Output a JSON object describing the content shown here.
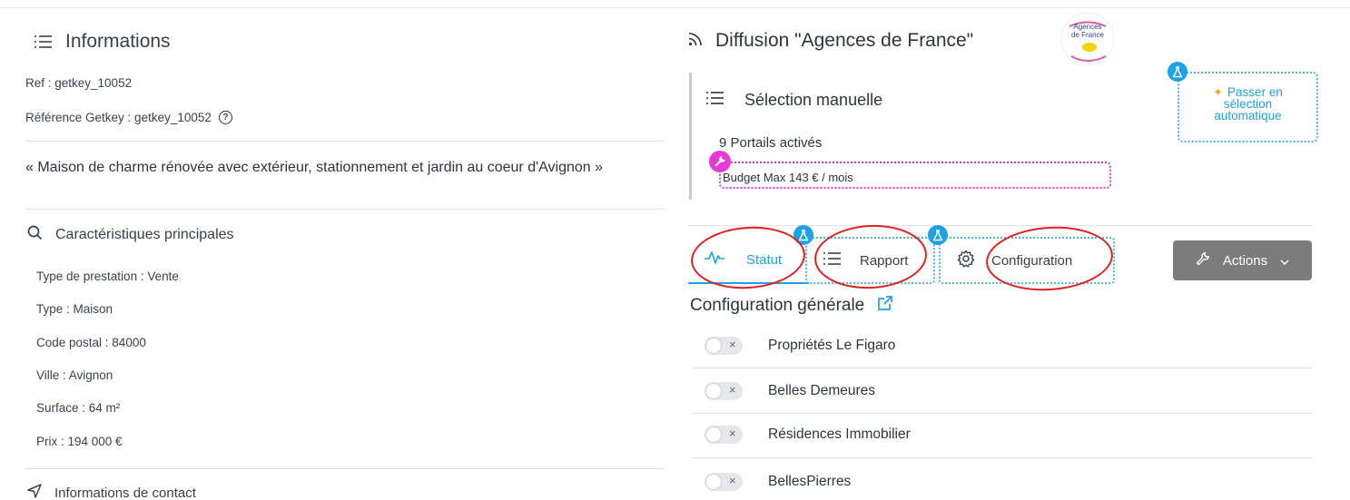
{
  "info": {
    "title": "Informations",
    "ref": "Ref : getkey_10052",
    "ref_getkey": "Référence Getkey : getkey_10052",
    "help_glyph": "?",
    "description": "« Maison de charme rénovée avec extérieur, stationnement et jardin au coeur d'Avignon »",
    "features_title": "Caractéristiques principales",
    "features": [
      "Type de prestation : Vente",
      "Type : Maison",
      "Code postal : 84000",
      "Ville : Avignon",
      "Surface : 64 m²",
      "Prix : 194 000 €"
    ],
    "contact_title": "Informations de contact"
  },
  "diffusion": {
    "title": "Diffusion \"Agences de France\"",
    "logo_text": [
      "Agences",
      "de France"
    ],
    "selection_title": "Sélection manuelle",
    "portals_count": "9 Portails activés",
    "budget": "Budget Max 143 € / mois",
    "auto_button": [
      "Passer en",
      "sélection",
      "automatique"
    ]
  },
  "tabs": [
    {
      "label": "Statut",
      "icon": "activity-icon",
      "active": true
    },
    {
      "label": "Rapport",
      "icon": "list-icon",
      "active": false
    },
    {
      "label": "Configuration",
      "icon": "gear-icon",
      "active": false
    }
  ],
  "actions_label": "Actions",
  "config": {
    "title": "Configuration générale",
    "portals": [
      {
        "name": "Propriétés Le Figaro",
        "enabled": false
      },
      {
        "name": "Belles Demeures",
        "enabled": false
      },
      {
        "name": "Résidences Immobilier",
        "enabled": false
      },
      {
        "name": "BellesPierres",
        "enabled": false
      }
    ]
  },
  "colors": {
    "accent": "#1ea2e6",
    "magenta": "#e63ad8",
    "annotation_red": "#e02020",
    "actions_bg": "#7c7c7c"
  }
}
